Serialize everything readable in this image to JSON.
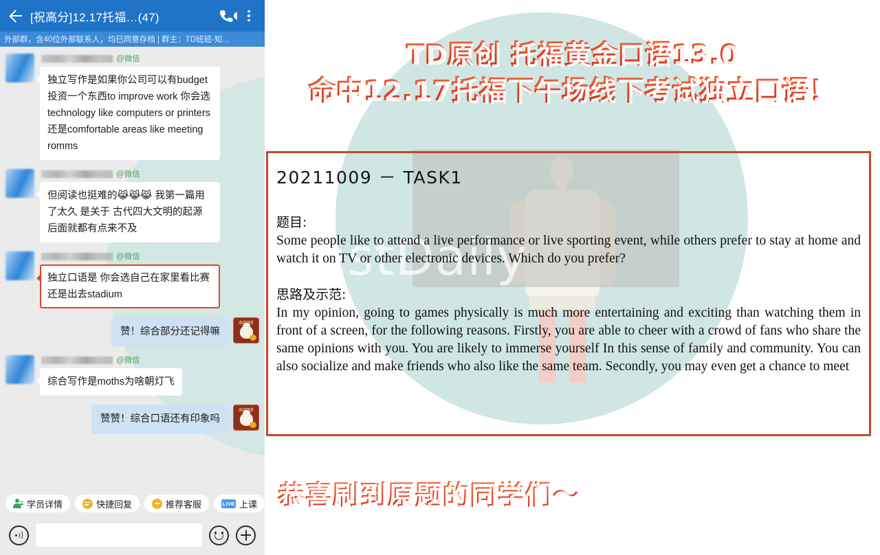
{
  "chat": {
    "header": {
      "back_icon": "back-arrow-icon",
      "title": "[祝高分]12.17托福…(47)",
      "call_icon": "video-call-icon",
      "more_icon": "more-options-icon"
    },
    "subheader": "外部群，含40位外部联系人，均已同意存档 | 群主：TD班班-知…",
    "messages": [
      {
        "side": "in",
        "sender_tag": "@微信",
        "text": "独立写作是如果你公司可以有budget投资一个东西to improve work 你会选technology like computers or printers 还是comfortable areas like meeting romms",
        "highlighted": false
      },
      {
        "side": "in",
        "sender_tag": "@微信",
        "text": "但阅读也挺难的😹😹😹 我第一篇用了太久 是关于 古代四大文明的起源 后面就都有点来不及",
        "highlighted": false
      },
      {
        "side": "in",
        "sender_tag": "@微信",
        "text": "独立口语是 你会选自己在家里看比赛还是出去stadium",
        "highlighted": true
      },
      {
        "side": "out",
        "sender_tag": "",
        "text": "赞！综合部分还记得嘛",
        "highlighted": false
      },
      {
        "side": "in",
        "sender_tag": "@微信",
        "text": "综合写作是moths为啥朝灯飞",
        "highlighted": false
      },
      {
        "side": "out",
        "sender_tag": "",
        "text": "赞赞！综合口语还有印象吗",
        "highlighted": false
      }
    ],
    "quick_actions": [
      {
        "label": "学员详情",
        "icon": "person-detail-icon"
      },
      {
        "label": "快捷回复",
        "icon": "quick-reply-icon"
      },
      {
        "label": "推荐客服",
        "icon": "recommend-service-icon"
      },
      {
        "label": "上课",
        "icon": "live-class-icon",
        "badge": "LIVE"
      }
    ],
    "composer": {
      "voice_icon": "voice-input-icon",
      "input_value": "",
      "input_placeholder": "",
      "emoji_icon": "smiley-icon",
      "plus_icon": "plus-icon"
    }
  },
  "poster": {
    "headline_line1": "TD原创 托福黄金口语13.0",
    "headline_line2": "命中12.17托福下午场线下考试独立口语！",
    "card": {
      "title": "20211009 － TASK1",
      "question_label": "题目:",
      "question_text": "Some people like to attend a live performance or live sporting event, while others prefer to stay at home and watch it on TV or other electronic devices. Which do you prefer?",
      "answer_label": "思路及示范:",
      "answer_text": "In my opinion, going to games physically is much more entertaining and exciting than watching them in front of a screen, for the following reasons. Firstly, you are able to cheer with a crowd of fans who share the same opinions with you. You are likely to immerse yourself In this sense of family and community. You can also socialize and make friends who also like the same team. Secondly, you may even get a chance to meet"
    },
    "watermark": "TestDaily",
    "footer_line": "恭喜刷到原题的同学们～",
    "colors": {
      "accent_red": "#d9472b",
      "card_border": "#c4482a",
      "circle_bg": "#cfe6e4",
      "header_blue": "#1f74c8",
      "subheader_blue": "#3d8ad9",
      "out_bubble": "#cfe2f3",
      "tag_green": "#42a95f"
    }
  }
}
